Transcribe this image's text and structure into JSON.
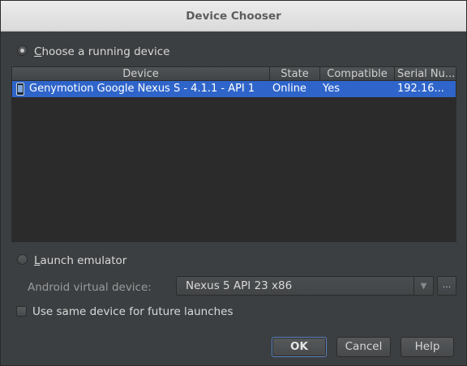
{
  "dialog": {
    "title": "Device Chooser"
  },
  "running": {
    "option_label_first": "C",
    "option_label_rest": "hoose a running device",
    "selected": true
  },
  "table": {
    "headers": [
      "Device",
      "State",
      "Compatible",
      "Serial Nu..."
    ],
    "rows": [
      {
        "device": "Genymotion Google Nexus S - 4.1.1 - API 1",
        "state": "Online",
        "compatible": "Yes",
        "serial": "192.16...",
        "selected": true
      }
    ]
  },
  "emulator": {
    "option_label_first": "L",
    "option_label_rest": "aunch emulator",
    "selected": false,
    "avd_label": "Android virtual device:",
    "avd_value": "Nexus 5 API 23 x86",
    "browse_label": "..."
  },
  "reuse": {
    "label": "Use same device for future launches",
    "checked": false
  },
  "buttons": {
    "ok": "OK",
    "cancel": "Cancel",
    "help": "Help"
  },
  "colors": {
    "selection": "#2f65ca",
    "background": "#3c3f41"
  },
  "icons": {
    "device_row": "phone-icon",
    "combo_arrow": "chevron-down-icon"
  }
}
